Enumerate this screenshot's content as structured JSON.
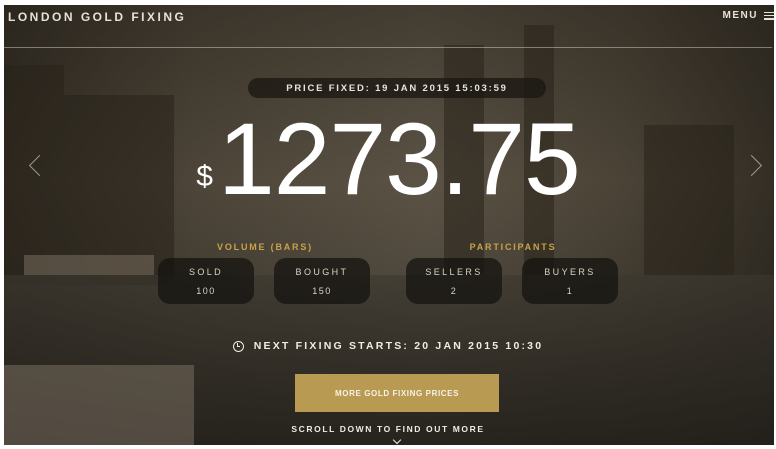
{
  "header": {
    "brand": "LONDON GOLD FIXING",
    "menu_label": "MENU",
    "menu_icon": "hamburger-icon"
  },
  "fix": {
    "price_fixed_label": "PRICE FIXED: 19 JAN 2015 15:03:59",
    "currency": "$",
    "price": "1273.75"
  },
  "navigation": {
    "prev_icon": "chevron-left-icon",
    "next_icon": "chevron-right-icon"
  },
  "volume": {
    "label": "VOLUME (BARS)",
    "sold_label": "SOLD",
    "sold_value": "100",
    "bought_label": "BOUGHT",
    "bought_value": "150"
  },
  "participants": {
    "label": "PARTICIPANTS",
    "sellers_label": "SELLERS",
    "sellers_value": "2",
    "buyers_label": "BUYERS",
    "buyers_value": "1"
  },
  "next_fixing": {
    "icon": "clock-icon",
    "text": "NEXT FIXING STARTS: 20 JAN 2015 10:30"
  },
  "cta": {
    "label": "MORE GOLD FIXING PRICES"
  },
  "scroll": {
    "text": "SCROLL DOWN TO FIND OUT MORE",
    "icon": "chevron-down-icon"
  },
  "colors": {
    "accent_gold": "#c9a24a",
    "button_gold": "#b89a52",
    "text_light": "#f0ece2"
  }
}
